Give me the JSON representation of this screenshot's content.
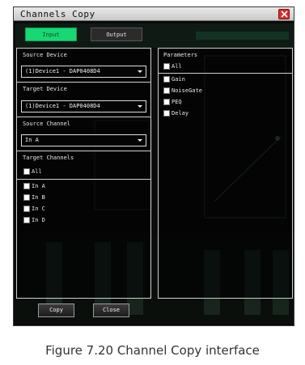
{
  "dialog": {
    "title": "Channels Copy",
    "tabs": {
      "input": "Input",
      "output": "Output"
    },
    "left": {
      "source_device_label": "Source Device",
      "source_device_value": "(1)Device1 - DAP0408D4",
      "target_device_label": "Target Device",
      "target_device_value": "(1)Device1 - DAP0408D4",
      "source_channel_label": "Source Channel",
      "source_channel_value": "In A",
      "target_channels_label": "Target Channels",
      "all_label": "All",
      "channels": [
        "In A",
        "In B",
        "In C",
        "In D"
      ]
    },
    "right": {
      "parameters_label": "Parameters",
      "all_label": "All",
      "params": [
        "Gain",
        "NoiseGate",
        "PEQ",
        "Delay"
      ]
    },
    "buttons": {
      "copy": "Copy",
      "close": "Close"
    }
  },
  "caption": "Figure 7.20 Channel Copy interface",
  "colors": {
    "active_tab": "#17d873",
    "close_button": "#d62c2c",
    "window_bg": "#0b0b0b"
  }
}
